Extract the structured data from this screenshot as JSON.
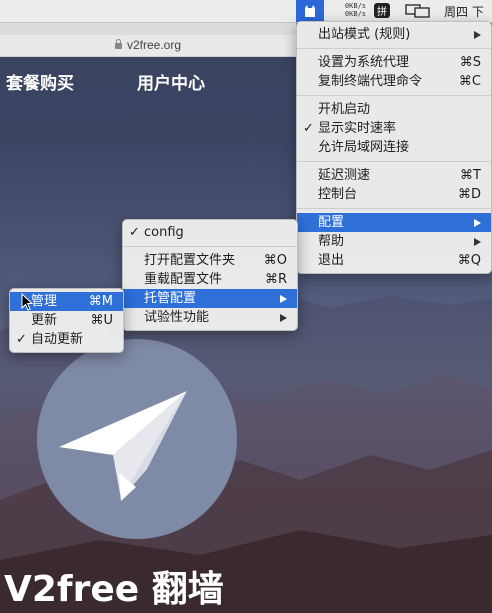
{
  "menubar": {
    "speed_up": "0KB/s",
    "speed_down": "0KB/s",
    "ime_label": "拼",
    "clock": "周四 下",
    "icons": [
      "v2ray-app-icon",
      "display-mirror-icon"
    ]
  },
  "browser": {
    "url": "v2free.org"
  },
  "site": {
    "nav": [
      "套餐购买",
      "用户中心"
    ],
    "hero_title": "V2free 翻墙"
  },
  "main_menu": {
    "items": [
      {
        "label": "出站模式 (规则)",
        "submenu": true
      },
      {
        "label": "设置为系统代理",
        "shortcut": "⌘S"
      },
      {
        "label": "复制终端代理命令",
        "shortcut": "⌘C"
      },
      {
        "label": "开机启动"
      },
      {
        "label": "显示实时速率",
        "checked": true
      },
      {
        "label": "允许局域网连接"
      },
      {
        "label": "延迟测速",
        "shortcut": "⌘T"
      },
      {
        "label": "控制台",
        "shortcut": "⌘D"
      },
      {
        "label": "配置",
        "submenu": true,
        "highlighted": true
      },
      {
        "label": "帮助",
        "submenu": true
      },
      {
        "label": "退出",
        "shortcut": "⌘Q"
      }
    ]
  },
  "config_menu": {
    "items": [
      {
        "label": "config",
        "checked": true
      },
      {
        "label": "打开配置文件夹",
        "shortcut": "⌘O"
      },
      {
        "label": "重载配置文件",
        "shortcut": "⌘R"
      },
      {
        "label": "托管配置",
        "submenu": true,
        "highlighted": true
      },
      {
        "label": "试验性功能",
        "submenu": true
      }
    ]
  },
  "managed_menu": {
    "items": [
      {
        "label": "管理",
        "shortcut": "⌘M",
        "highlighted": true
      },
      {
        "label": "更新",
        "shortcut": "⌘U"
      },
      {
        "label": "自动更新",
        "checked": true
      }
    ]
  },
  "colors": {
    "highlight": "#2f6fd8",
    "menu_bg": "#eeeeee",
    "logo_circle": "#7f8aa6"
  }
}
